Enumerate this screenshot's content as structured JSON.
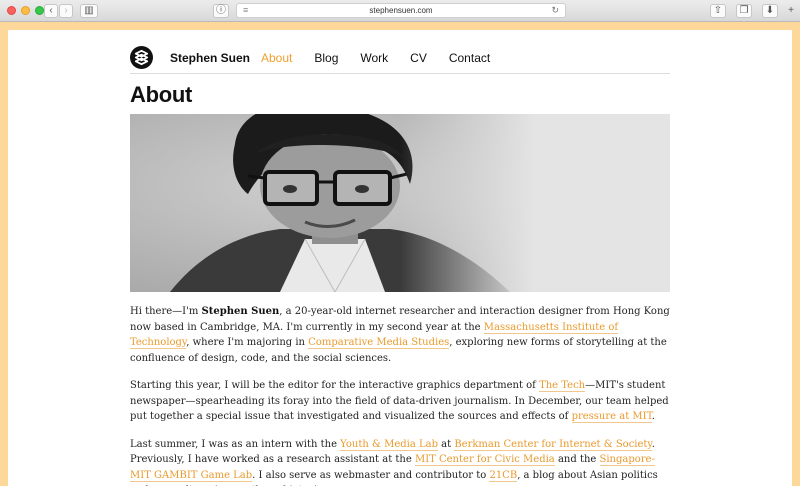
{
  "browser": {
    "url": "stephensuen.com",
    "back_icon": "chevron-left-icon",
    "forward_icon": "chevron-right-icon"
  },
  "site": {
    "brand": "Stephen Suen",
    "nav": [
      "About",
      "Blog",
      "Work",
      "CV",
      "Contact"
    ],
    "active_nav": "About",
    "accent_color": "#f0a030"
  },
  "page": {
    "title": "About",
    "p1": {
      "t1": "Hi there—I'm ",
      "name": "Stephen Suen",
      "t2": ", a 20-year-old internet researcher and interaction designer from Hong Kong now based in Cambridge, MA. I'm currently in my second year at the ",
      "l1": "Massachusetts Institute of Technology",
      "t3": ", where I'm majoring in ",
      "l2": "Comparative Media Studies",
      "t4": ", exploring new forms of storytelling at the confluence of design, code, and the social sciences."
    },
    "p2": {
      "t1": "Starting this year, I will be the editor for the interactive graphics department of ",
      "l1": "The Tech",
      "t2": "—MIT's student newspaper—spearheading its foray into the field of data-driven journalism. In December, our team helped put together a special issue that investigated and visualized the sources and effects of ",
      "l2": "pressure at MIT",
      "t3": "."
    },
    "p3": {
      "t1": "Last summer, I was as an intern with the ",
      "l1": "Youth & Media Lab",
      "t2": " at ",
      "l2": "Berkman Center for Internet & Society",
      "t3": ". Previously, I have worked as a research assistant at the ",
      "l3": "MIT Center for Civic Media",
      "t4": " and the ",
      "l4": "Singapore-MIT GAMBIT Game Lab",
      "t5": ". I also serve as webmaster and contributor to ",
      "l5": "21CB",
      "t6": ", a blog about Asian politics and pop culture (currently on hiatus)."
    }
  }
}
